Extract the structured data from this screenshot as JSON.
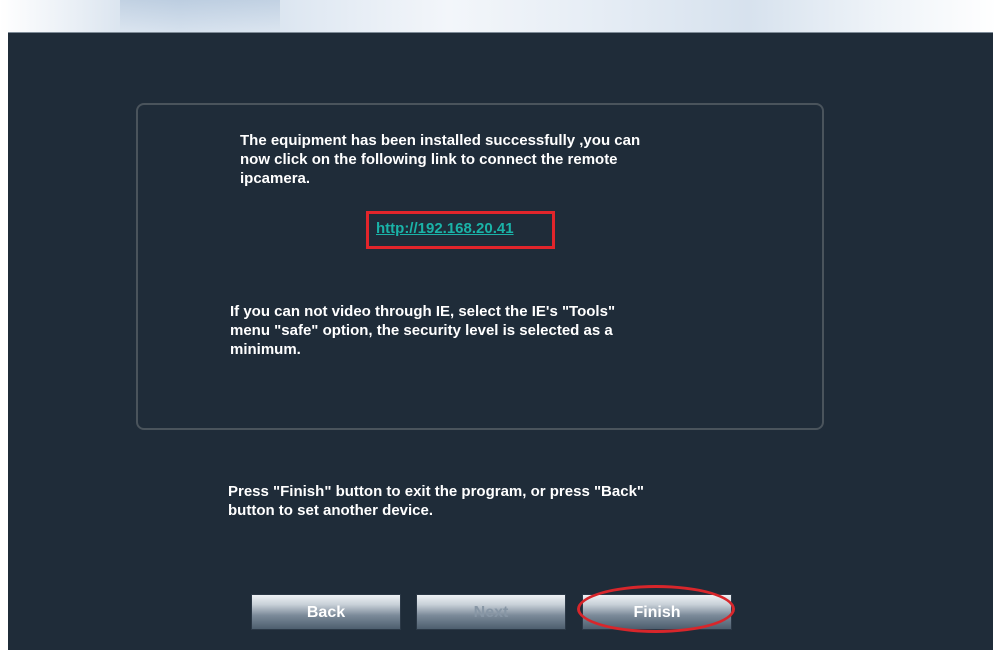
{
  "messages": {
    "install_success": "The equipment has been installed successfully ,you can\nnow click on the following link to connect the remote\nipcamera.",
    "camera_link": "http://192.168.20.41",
    "ie_hint": "If you can not video through IE, select the IE's \"Tools\"\nmenu  \"safe\" option, the security level is selected as a\nminimum.",
    "exit_hint": "Press \"Finish\" button to exit the program, or press \"Back\"\nbutton to set another device."
  },
  "buttons": {
    "back": "Back",
    "next": "Next",
    "finish": "Finish"
  },
  "colors": {
    "background": "#1f2c39",
    "link": "#1ab3a8",
    "highlight": "#e1252b"
  }
}
